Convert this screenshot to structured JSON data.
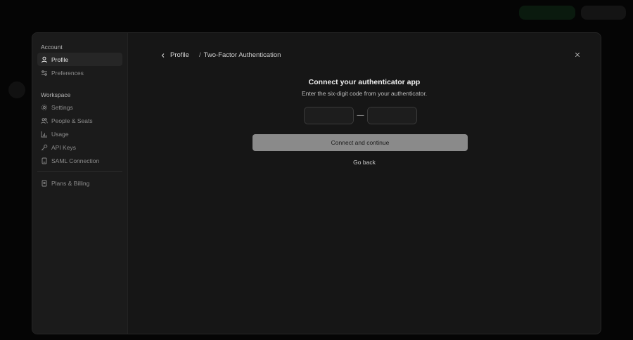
{
  "sidebar": {
    "sections": [
      {
        "label": "Account",
        "items": [
          {
            "label": "Profile",
            "icon": "user-icon",
            "active": true
          },
          {
            "label": "Preferences",
            "icon": "sliders-icon"
          }
        ]
      },
      {
        "label": "Workspace",
        "items": [
          {
            "label": "Settings",
            "icon": "gear-icon"
          },
          {
            "label": "People & Seats",
            "icon": "people-icon"
          },
          {
            "label": "Usage",
            "icon": "bar-chart-icon"
          },
          {
            "label": "API Keys",
            "icon": "key-icon"
          },
          {
            "label": "SAML Connection",
            "icon": "saml-icon"
          }
        ]
      }
    ],
    "footer_items": [
      {
        "label": "Plans & Billing",
        "icon": "receipt-icon"
      }
    ]
  },
  "breadcrumb": {
    "parent": "Profile",
    "separator": "/",
    "current": "Two-Factor Authentication"
  },
  "dialog": {
    "title": "Connect your authenticator app",
    "subtitle": "Enter the six-digit code from your authenticator.",
    "code_separator": "—",
    "code_values": [
      "",
      "",
      "",
      "",
      "",
      ""
    ],
    "primary_label": "Connect and continue",
    "secondary_label": "Go back"
  },
  "colors": {
    "background": "#050505",
    "modal": "#161616",
    "sidebar": "#1b1b1b",
    "primary_button": "#8a8a8a"
  }
}
